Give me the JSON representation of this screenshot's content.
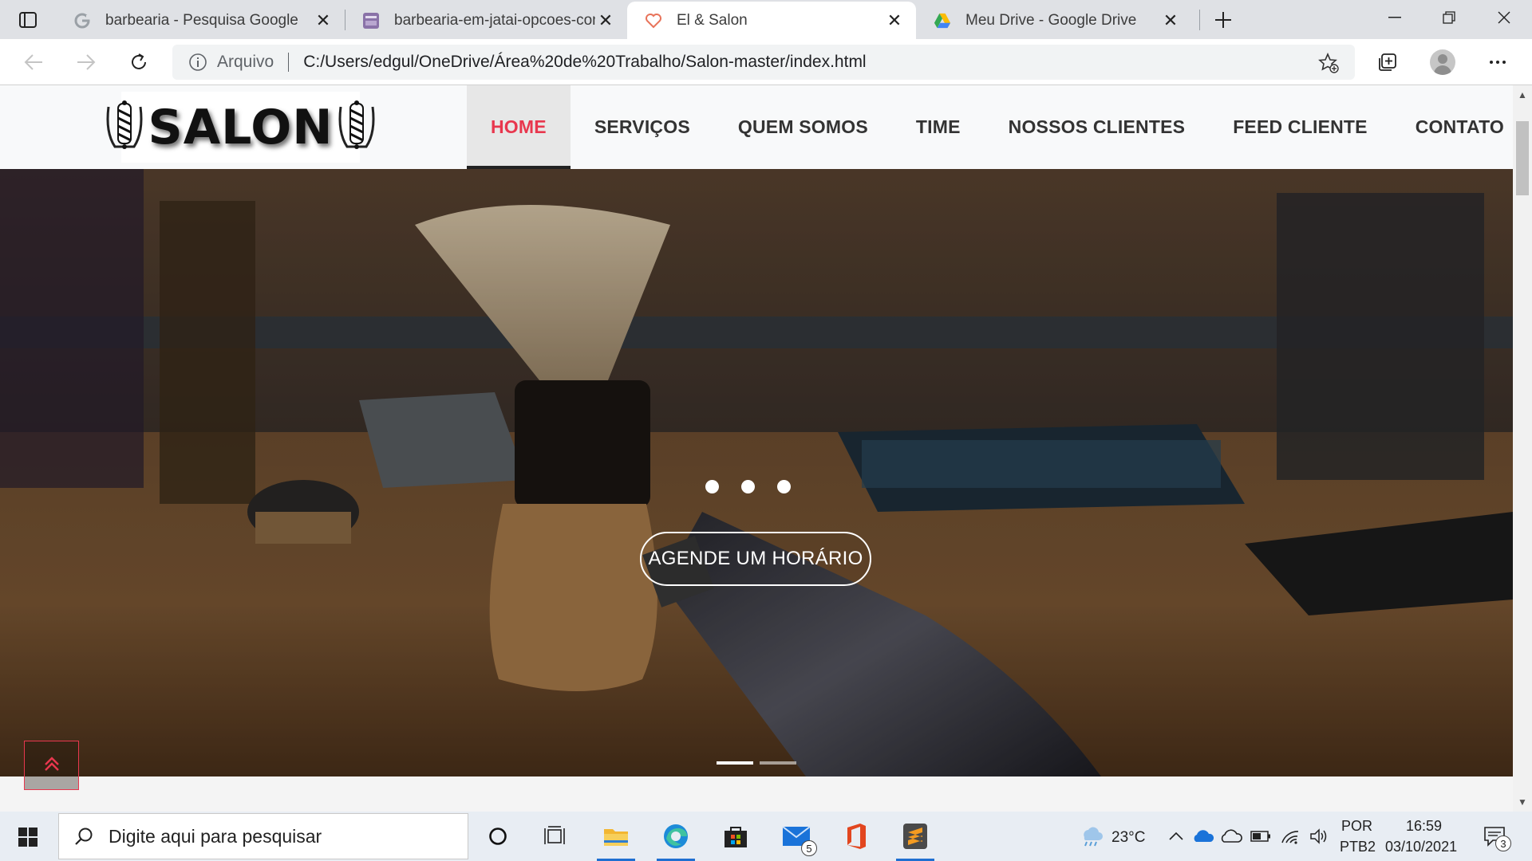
{
  "browser": {
    "tabs": [
      {
        "title": "barbearia - Pesquisa Google",
        "icon": "google-g-icon",
        "active": false
      },
      {
        "title": "barbearia-em-jatai-opcoes-com-",
        "icon": "site-favicon-icon",
        "active": false
      },
      {
        "title": "El & Salon",
        "icon": "heart-favicon-icon",
        "active": true
      },
      {
        "title": "Meu Drive - Google Drive",
        "icon": "google-drive-icon",
        "active": false
      }
    ],
    "address": {
      "protocol_label": "Arquivo",
      "url": "C:/Users/edgul/OneDrive/Área%20de%20Trabalho/Salon-master/index.html"
    }
  },
  "site": {
    "logo_text": "SALON",
    "nav": [
      {
        "label": "HOME",
        "active": true
      },
      {
        "label": "SERVIÇOS",
        "active": false
      },
      {
        "label": "QUEM SOMOS",
        "active": false
      },
      {
        "label": "TIME",
        "active": false
      },
      {
        "label": "NOSSOS CLIENTES",
        "active": false
      },
      {
        "label": "FEED CLIENTE",
        "active": false
      },
      {
        "label": "CONTATO",
        "active": false
      }
    ],
    "hero": {
      "cta_label": "AGENDE UM HORÁRIO",
      "carousel_dots": 3,
      "slide_indicators": 2,
      "active_indicator": 1
    },
    "accent_color": "#e8374e"
  },
  "taskbar": {
    "search_placeholder": "Digite aqui para pesquisar",
    "apps": [
      {
        "name": "cortana",
        "icon": "cortana-circle-icon"
      },
      {
        "name": "task-view",
        "icon": "task-view-icon"
      },
      {
        "name": "file-explorer",
        "icon": "folder-icon"
      },
      {
        "name": "edge",
        "icon": "edge-icon"
      },
      {
        "name": "store",
        "icon": "store-bag-icon"
      },
      {
        "name": "mail",
        "icon": "mail-icon",
        "badge": "5"
      },
      {
        "name": "office",
        "icon": "office-icon"
      },
      {
        "name": "sublime",
        "icon": "sublime-icon"
      }
    ],
    "weather": "23°C",
    "language_top": "POR",
    "language_bottom": "PTB2",
    "time": "16:59",
    "date": "03/10/2021",
    "notifications": "3"
  }
}
